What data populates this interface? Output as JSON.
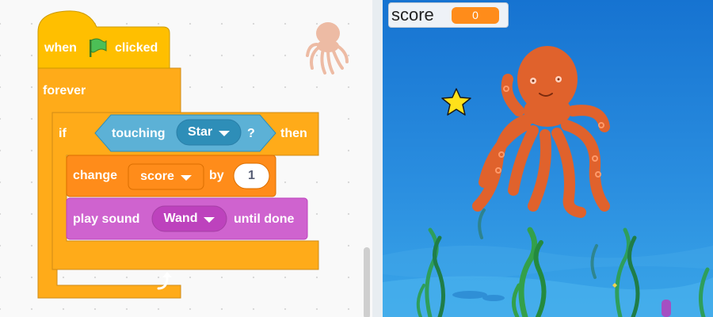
{
  "blocks": {
    "hat": {
      "when": "when",
      "clicked": "clicked"
    },
    "forever": {
      "label": "forever"
    },
    "if_block": {
      "if": "if",
      "then": "then"
    },
    "touching": {
      "label": "touching",
      "target": "Star",
      "question": "?"
    },
    "change": {
      "label": "change",
      "variable": "score",
      "by": "by",
      "amount": "1"
    },
    "sound": {
      "label": "play sound",
      "sound": "Wand",
      "suffix": "until done"
    }
  },
  "monitor": {
    "label": "score",
    "value": "0"
  },
  "sprites": {
    "octopus": "octopus-sprite",
    "star": "star-sprite"
  },
  "colors": {
    "events": "#ffbf00",
    "control": "#ffab19",
    "sensing": "#5cb1d6",
    "variables": "#ff8c1a",
    "sound": "#cf63cf",
    "stage_water": "#1f7fd6"
  }
}
